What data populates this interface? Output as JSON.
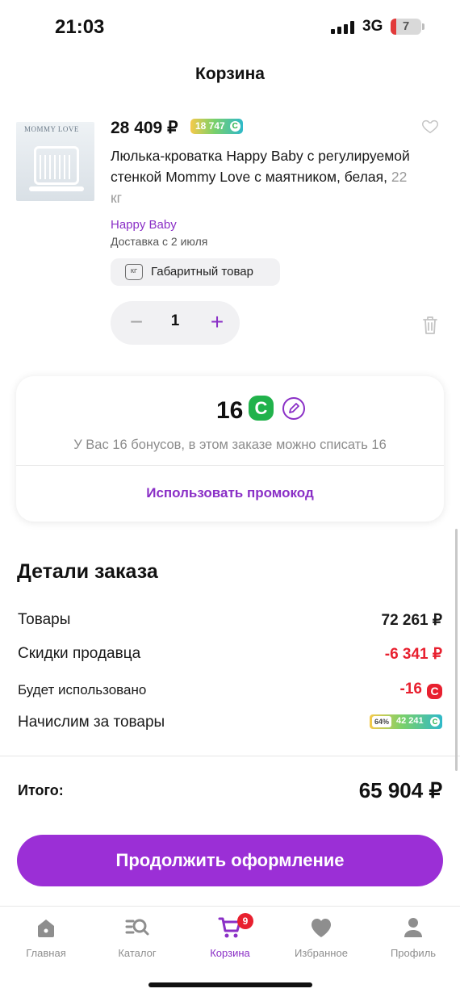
{
  "status_bar": {
    "time": "21:03",
    "network": "3G",
    "battery": "7",
    "battery_level": 0.07
  },
  "header": {
    "title": "Корзина"
  },
  "cart_item": {
    "thumb_brand": "MOMMY LOVE",
    "price": "28 409 ₽",
    "bonus": "18 747",
    "name": "Люлька-кроватка Happy Baby с регулируемой стенкой Mommy Love с маятником, белая,",
    "weight": "22 кг",
    "brand": "Happy Baby",
    "delivery": "Доставка с 2 июля",
    "oversize_icon_text": "КГ",
    "oversize_label": "Габаритный товар",
    "quantity": "1",
    "minus": "−",
    "plus": "+"
  },
  "bonus_card": {
    "count": "16",
    "currency_glyph": "C",
    "hint": "У Вас 16 бонусов, в этом заказе можно списать 16",
    "promo": "Использовать промокод"
  },
  "order_details": {
    "title": "Детали заказа",
    "rows": [
      {
        "label": "Товары",
        "value": "72 261 ₽"
      },
      {
        "label": "Скидки продавца",
        "value": "-6 341 ₽"
      },
      {
        "label": "Будет использовано",
        "value": "-16"
      },
      {
        "label": "Начислим за товары",
        "percent": "64%",
        "value": "42 241"
      }
    ],
    "total_label": "Итого:",
    "total_value": "65 904 ₽"
  },
  "checkout": {
    "label": "Продолжить оформление"
  },
  "tabbar": {
    "items": [
      {
        "label": "Главная",
        "icon": "home-icon"
      },
      {
        "label": "Каталог",
        "icon": "catalog-search-icon"
      },
      {
        "label": "Корзина",
        "icon": "cart-icon",
        "badge": "9",
        "active": true
      },
      {
        "label": "Избранное",
        "icon": "heart-icon"
      },
      {
        "label": "Профиль",
        "icon": "profile-icon"
      }
    ]
  },
  "colors": {
    "accent": "#8a2fc6",
    "button": "#9b2fd6",
    "red": "#e8202f",
    "bonus_green": "#21b24b"
  }
}
